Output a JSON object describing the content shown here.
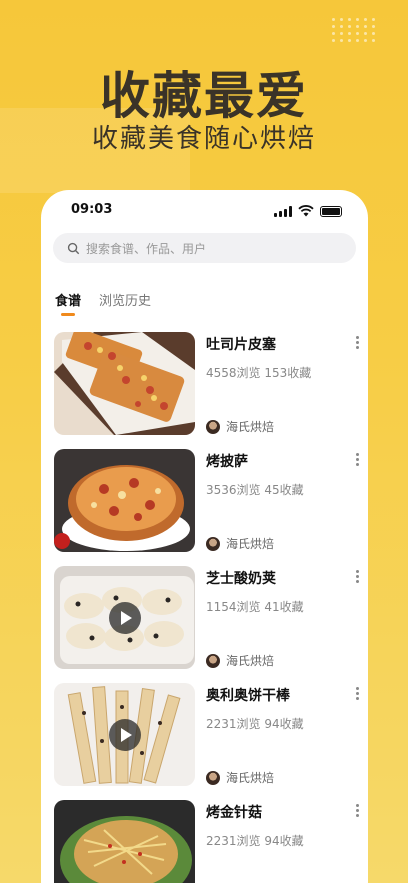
{
  "hero": {
    "title": "收藏最爱",
    "subtitle": "收藏美食随心烘焙"
  },
  "status_bar": {
    "time": "09:03"
  },
  "search": {
    "placeholder": "搜索食谱、作品、用户"
  },
  "tabs": [
    {
      "label": "食谱",
      "active": true
    },
    {
      "label": "浏览历史",
      "active": false
    }
  ],
  "recipes": [
    {
      "name": "吐司片皮塞",
      "stats": "4558浏览 153收藏",
      "author": "海氏烘焙",
      "video": false,
      "thumb_icon": "toast-pizza-image"
    },
    {
      "name": "烤披萨",
      "stats": "3536浏览 45收藏",
      "author": "海氏烘焙",
      "video": false,
      "thumb_icon": "pizza-image"
    },
    {
      "name": "芝士酸奶荚",
      "stats": "1154浏览 41收藏",
      "author": "海氏烘焙",
      "video": true,
      "thumb_icon": "cheese-yogurt-pastry-image"
    },
    {
      "name": "奥利奥饼干棒",
      "stats": "2231浏览 94收藏",
      "author": "海氏烘焙",
      "video": true,
      "thumb_icon": "oreo-biscuit-stick-image"
    },
    {
      "name": "烤金针菇",
      "stats": "2231浏览 94收藏",
      "author": "",
      "video": false,
      "thumb_icon": "grilled-enoki-image"
    }
  ],
  "colors": {
    "background": "#f6c73a",
    "accent": "#f08a1c",
    "card": "#ffffff"
  }
}
